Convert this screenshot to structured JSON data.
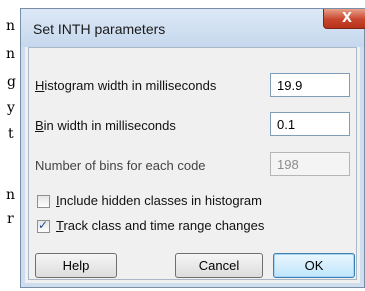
{
  "background": {
    "fragments": [
      "n",
      "n",
      "g",
      "y",
      "t",
      "n",
      "r"
    ]
  },
  "dialog": {
    "title": "Set INTH parameters",
    "close_label": "X",
    "fields": [
      {
        "label": "Histogram width in milliseconds",
        "accel": "H",
        "rest": "istogram width in milliseconds",
        "value": "19.9",
        "enabled": true
      },
      {
        "label": "Bin width in milliseconds",
        "accel": "B",
        "rest": "in width in milliseconds",
        "value": "0.1",
        "enabled": true
      },
      {
        "label": "Number of bins for each code",
        "value": "198",
        "enabled": false
      }
    ],
    "checkboxes": [
      {
        "label": "Include hidden classes in histogram",
        "accel": "I",
        "rest": "nclude hidden classes in histogram",
        "checked": false
      },
      {
        "label": "Track class and time range changes",
        "accel": "T",
        "rest": "rack class and time range changes",
        "checked": true
      }
    ],
    "buttons": {
      "help": "Help",
      "cancel": "Cancel",
      "ok": "OK"
    }
  }
}
